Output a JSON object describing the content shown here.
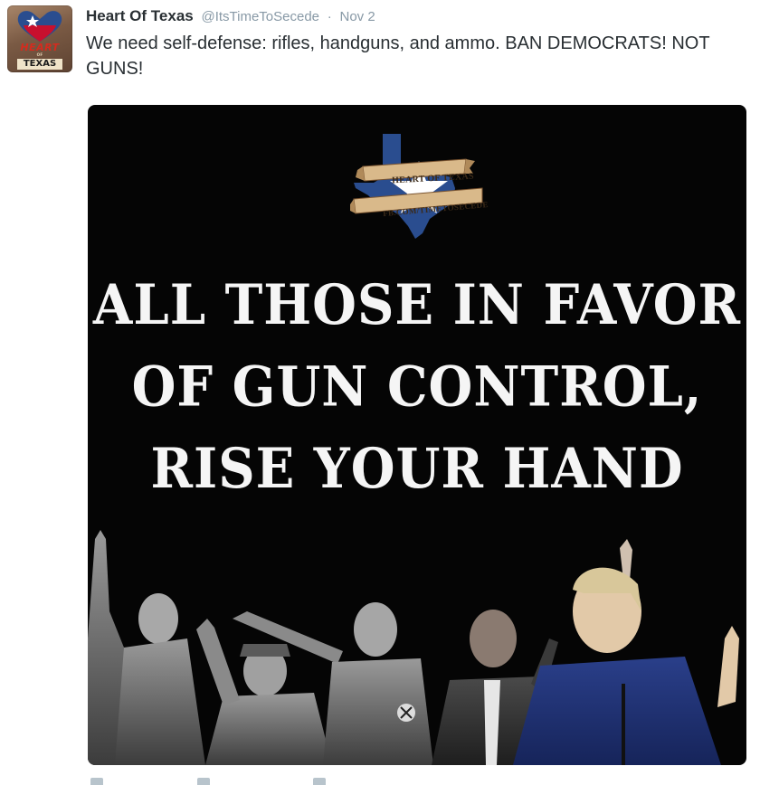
{
  "tweet": {
    "display_name": "Heart Of Texas",
    "handle": "@ItsTimeToSecede",
    "separator": "·",
    "timestamp": "Nov 2",
    "text": "We need self-defense: rifles, handguns, and ammo. BAN DEMOCRATS! NOT GUNS!"
  },
  "avatar": {
    "line1": "HEART",
    "line2": "OF",
    "line3": "TEXAS"
  },
  "media": {
    "logo_band_top": "HEART OF TEXAS",
    "logo_band_bottom": "FB.COM/TIMETOSECEDE",
    "headline": [
      "ALL THOSE IN FAVOR",
      "OF GUN CONTROL,",
      "RISE YOUR HAND"
    ]
  },
  "colors": {
    "text": "#292f33",
    "muted": "#8899a6",
    "card_bg": "#050505",
    "texas_blue": "#2a4d8f",
    "texas_red": "#c8102e"
  }
}
